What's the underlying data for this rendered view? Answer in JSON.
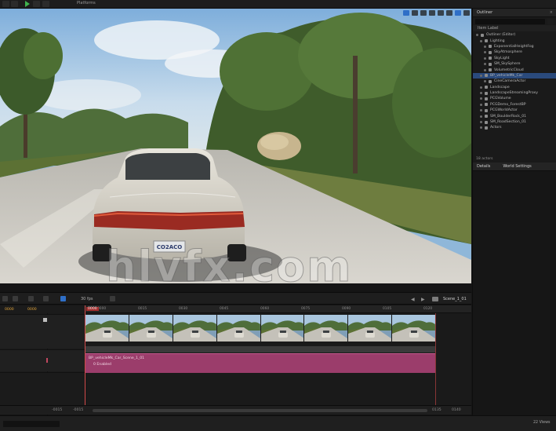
{
  "toolbar": {
    "platforms_label": "Platforms"
  },
  "viewport": {
    "watermark": "hlvfx.com"
  },
  "outliner": {
    "tab_label": "Outliner",
    "column_label": "Item Label",
    "items": [
      {
        "label": "Outliner (Editor)",
        "selected": false
      },
      {
        "label": "Lighting",
        "selected": false
      },
      {
        "label": "ExponentialHeightFog",
        "selected": false
      },
      {
        "label": "SkyAtmosphere",
        "selected": false
      },
      {
        "label": "SkyLight",
        "selected": false
      },
      {
        "label": "SM_SkySphere",
        "selected": false
      },
      {
        "label": "VolumetricCloud",
        "selected": false
      },
      {
        "label": "BP_vehicleMk_Car",
        "selected": true
      },
      {
        "label": "CineCameraActor",
        "selected": false
      },
      {
        "label": "Landscape",
        "selected": false
      },
      {
        "label": "LandscapeStreamingProxy",
        "selected": false
      },
      {
        "label": "PCGVolume",
        "selected": false
      },
      {
        "label": "PCGDemo_ForestBP",
        "selected": false
      },
      {
        "label": "PCGWorldActor",
        "selected": false
      },
      {
        "label": "SM_BoulderRock_01",
        "selected": false
      },
      {
        "label": "SM_RoadSection_01",
        "selected": false
      },
      {
        "label": "Actors",
        "selected": false
      }
    ],
    "actors_count": "18 actors"
  },
  "details": {
    "tab_label": "Details",
    "tab2_label": "World Settings",
    "footer": "22 Views"
  },
  "sequencer": {
    "fps_label": "30 fps",
    "sequence_name": "Scene_1_01",
    "frame_start": "0000",
    "frame_current": "0000",
    "playhead_label": "0000",
    "ruler_labels": [
      "0000",
      "0015",
      "0030",
      "0045",
      "0060",
      "0075",
      "0090",
      "0105",
      "0120"
    ],
    "track_name": "BP_vehicleMk_Car_Scene_1_01",
    "track_sub": "0 Enabled",
    "bottom_left": "-0015",
    "bottom_mid": "-0015",
    "bottom_right1": "0135",
    "bottom_right2": "0140"
  },
  "status": {
    "right_label": "22 Views"
  },
  "colors": {
    "accent_blue": "#2f6fc7",
    "playhead_red": "#d24a4a",
    "track_magenta": "#9b3d6b",
    "frame_orange": "#e0a43a"
  }
}
